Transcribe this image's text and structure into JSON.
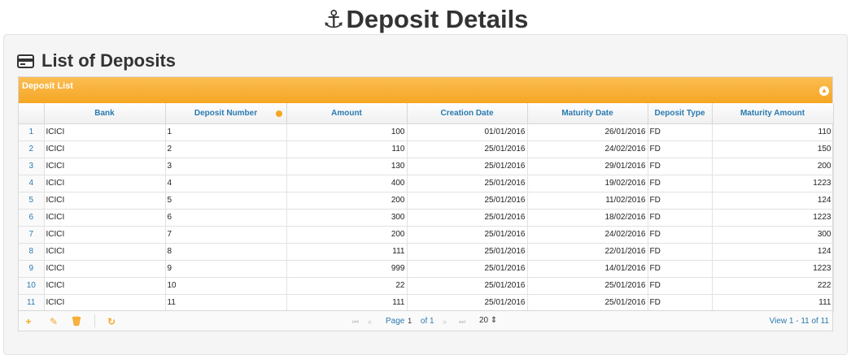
{
  "page": {
    "title": "Deposit Details"
  },
  "section": {
    "title": "List of Deposits"
  },
  "grid": {
    "caption": "Deposit List",
    "columns": [
      "",
      "Bank",
      "Deposit Number",
      "Amount",
      "Creation Date",
      "Maturity Date",
      "Deposit Type",
      "Maturity Amount"
    ],
    "rows": [
      [
        "1",
        "ICICI",
        "1",
        "100",
        "01/01/2016",
        "26/01/2016",
        "FD",
        "110"
      ],
      [
        "2",
        "ICICI",
        "2",
        "110",
        "25/01/2016",
        "24/02/2016",
        "FD",
        "150"
      ],
      [
        "3",
        "ICICI",
        "3",
        "130",
        "25/01/2016",
        "29/01/2016",
        "FD",
        "200"
      ],
      [
        "4",
        "ICICI",
        "4",
        "400",
        "25/01/2016",
        "19/02/2016",
        "FD",
        "1223"
      ],
      [
        "5",
        "ICICI",
        "5",
        "200",
        "25/01/2016",
        "11/02/2016",
        "FD",
        "124"
      ],
      [
        "6",
        "ICICI",
        "6",
        "300",
        "25/01/2016",
        "18/02/2016",
        "FD",
        "1223"
      ],
      [
        "7",
        "ICICI",
        "7",
        "200",
        "25/01/2016",
        "24/02/2016",
        "FD",
        "300"
      ],
      [
        "8",
        "ICICI",
        "8",
        "111",
        "25/01/2016",
        "22/01/2016",
        "FD",
        "124"
      ],
      [
        "9",
        "ICICI",
        "9",
        "999",
        "25/01/2016",
        "14/01/2016",
        "FD",
        "1223"
      ],
      [
        "10",
        "ICICI",
        "10",
        "22",
        "25/01/2016",
        "25/01/2016",
        "FD",
        "222"
      ],
      [
        "11",
        "ICICI",
        "11",
        "111",
        "25/01/2016",
        "25/01/2016",
        "FD",
        "111"
      ]
    ]
  },
  "pager": {
    "page_label": "Page",
    "page_value": "1",
    "of_label": "of 1",
    "rows_per_page": "20",
    "view_text": "View 1 - 11 of 11"
  },
  "icons": {
    "title": "anchor-icon",
    "section": "credit-card-icon",
    "add": "plus-icon",
    "edit": "pencil-icon",
    "delete": "trash-icon",
    "refresh": "refresh-icon"
  },
  "colors": {
    "caption_bar": "#f5a623",
    "link": "#2a7ab0",
    "panel_bg": "#f5f5f5"
  }
}
